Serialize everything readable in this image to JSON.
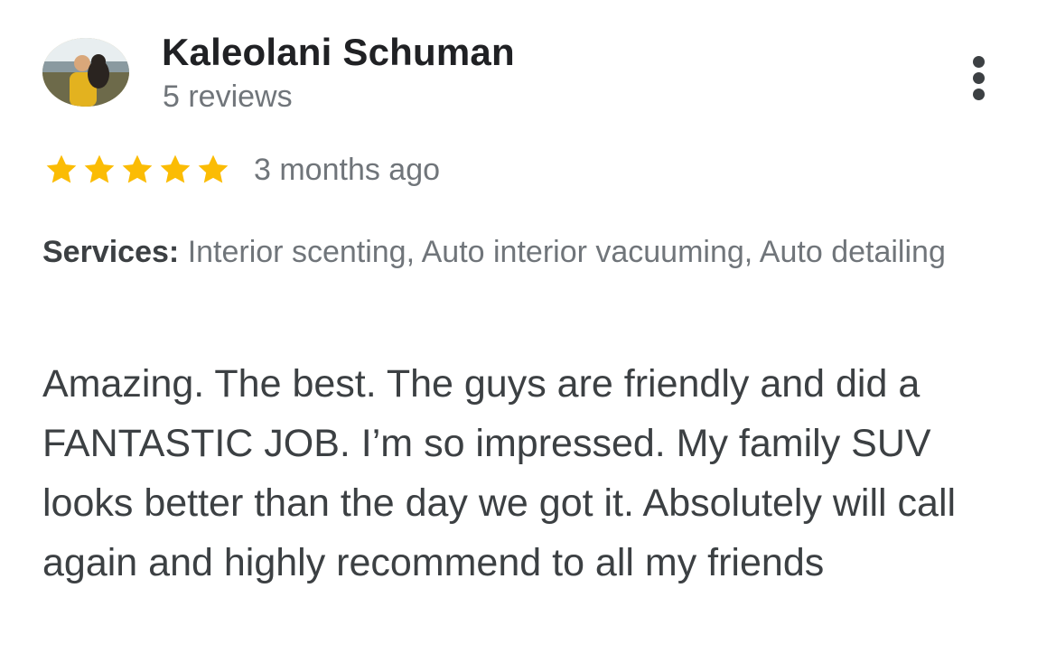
{
  "reviewer": {
    "name": "Kaleolani Schuman",
    "review_count": "5 reviews",
    "avatar_icon": "profile-photo"
  },
  "rating": {
    "stars": 5,
    "max_stars": 5,
    "star_color": "#fbbc04",
    "age": "3 months ago"
  },
  "services": {
    "label": "Services:",
    "value": "Interior scenting, Auto interior vacuuming, Auto detailing"
  },
  "review": {
    "text": "Amazing. The best. The guys are friendly and did a FANTASTIC JOB. I’m so impressed. My family SUV looks better than the day we got it. Absolutely will call again and highly recommend to all my friends"
  },
  "menu": {
    "icon": "more-vert-icon"
  }
}
